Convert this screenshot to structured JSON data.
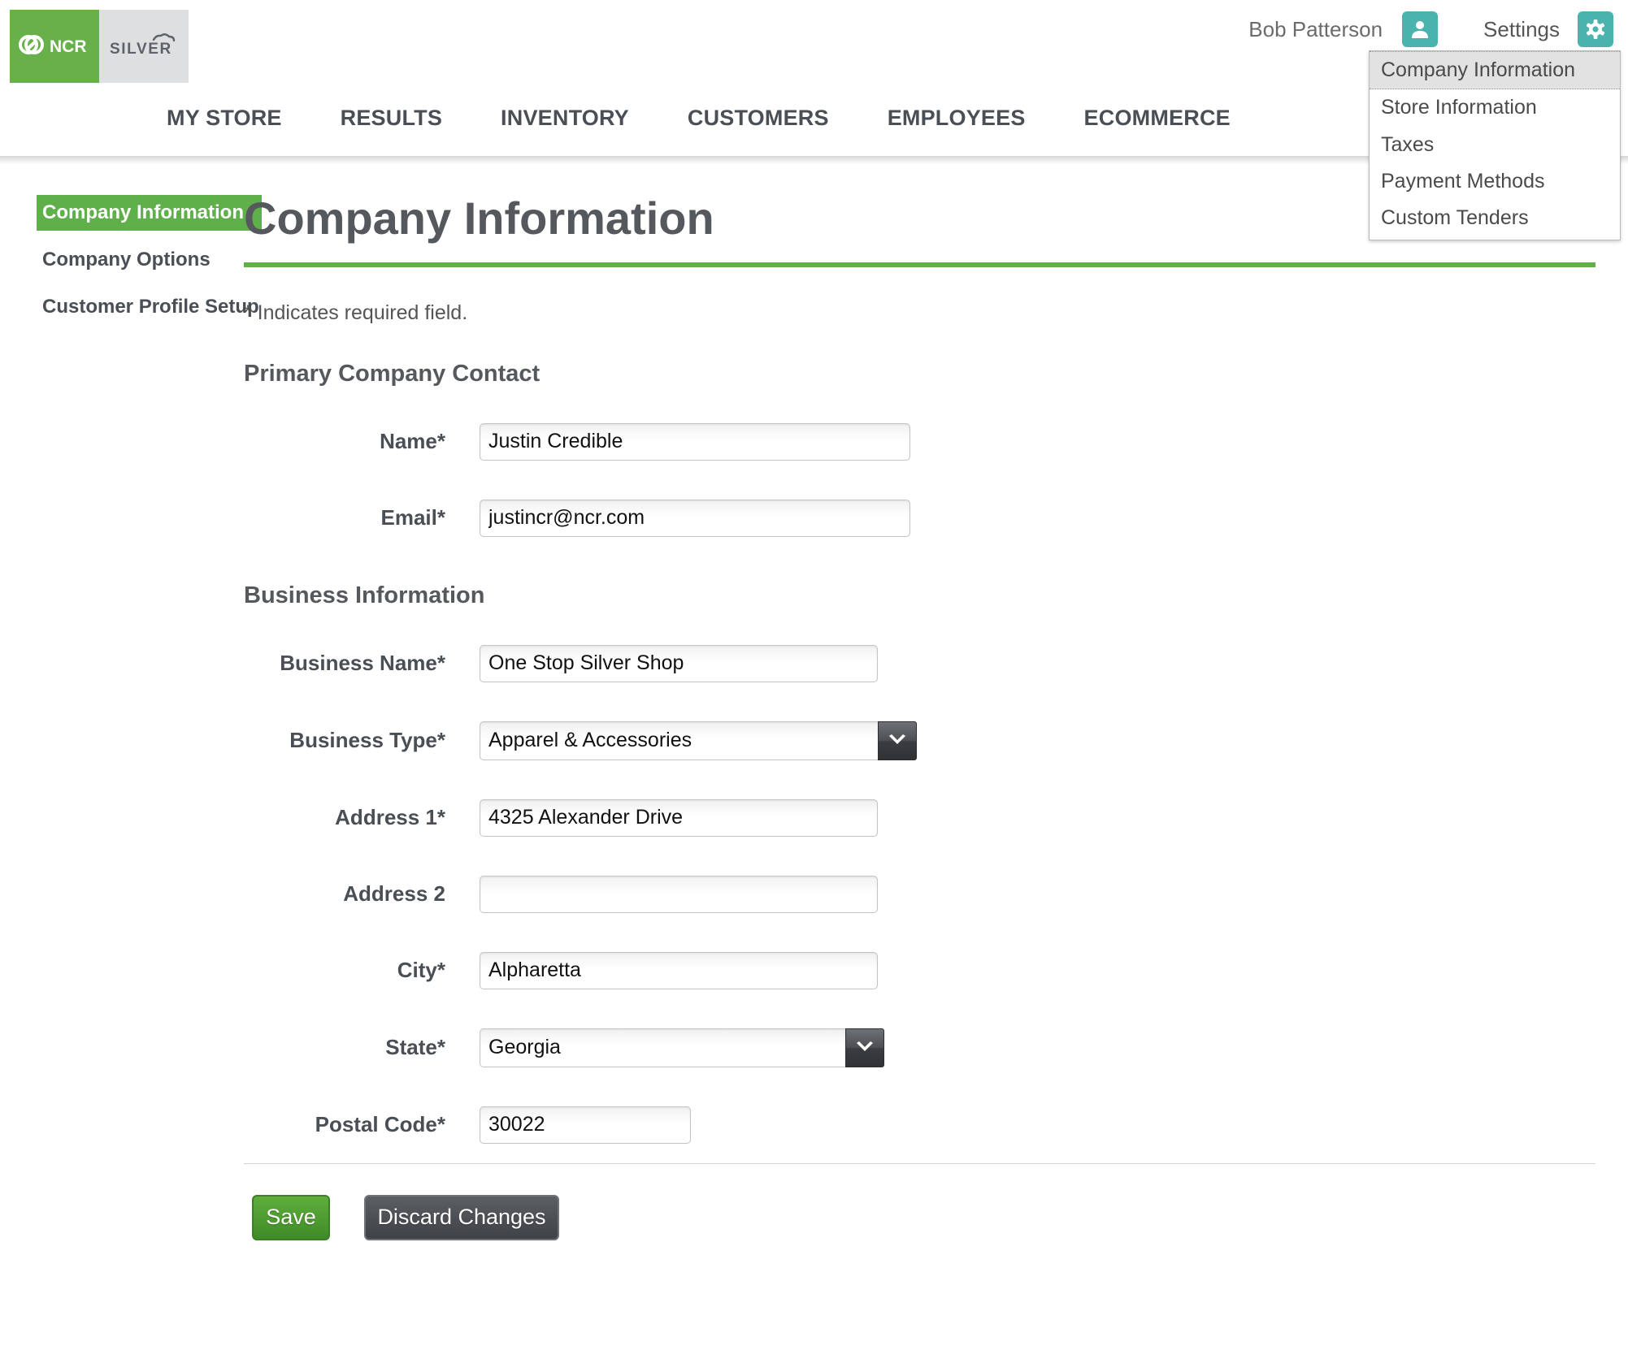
{
  "header": {
    "logo_primary": "NCR",
    "logo_secondary": "SILVER",
    "user_name": "Bob Patterson",
    "user_icon": "person-icon",
    "settings_label": "Settings",
    "settings_icon": "gear-icon",
    "accent_teal": "#4bb3ad",
    "accent_green": "#5fb04a"
  },
  "settings_menu": {
    "items": [
      {
        "label": "Company Information",
        "active": true
      },
      {
        "label": "Store Information",
        "active": false
      },
      {
        "label": "Taxes",
        "active": false
      },
      {
        "label": "Payment Methods",
        "active": false
      },
      {
        "label": "Custom Tenders",
        "active": false
      }
    ]
  },
  "main_nav": {
    "items": [
      {
        "label": "MY STORE"
      },
      {
        "label": "RESULTS"
      },
      {
        "label": "INVENTORY"
      },
      {
        "label": "CUSTOMERS"
      },
      {
        "label": "EMPLOYEES"
      },
      {
        "label": "ECOMMERCE"
      }
    ]
  },
  "sidebar": {
    "items": [
      {
        "label": "Company Information",
        "active": true
      },
      {
        "label": "Company Options",
        "active": false
      },
      {
        "label": "Customer Profile Setup",
        "active": false
      }
    ]
  },
  "main": {
    "title": "Company Information",
    "required_note": "* Indicates required field.",
    "sections": [
      {
        "title": "Primary Company Contact",
        "fields": [
          {
            "label": "Name*",
            "value": "Justin Credible",
            "type": "text",
            "placeholder": ""
          },
          {
            "label": "Email*",
            "value": "justincr@ncr.com",
            "type": "text",
            "placeholder": ""
          }
        ]
      },
      {
        "title": "Business Information",
        "fields": [
          {
            "label": "Business Name*",
            "value": "One Stop Silver Shop",
            "type": "text",
            "placeholder": ""
          },
          {
            "label": "Business Type*",
            "value": "Apparel & Accessories",
            "type": "select",
            "placeholder": ""
          },
          {
            "label": "Address 1*",
            "value": "4325 Alexander Drive",
            "type": "text",
            "placeholder": ""
          },
          {
            "label": "Address 2",
            "value": "",
            "type": "text",
            "placeholder": ""
          },
          {
            "label": "City*",
            "value": "Alpharetta",
            "type": "text",
            "placeholder": ""
          },
          {
            "label": "State*",
            "value": "Georgia",
            "type": "select",
            "placeholder": ""
          },
          {
            "label": "Postal Code*",
            "value": "30022",
            "type": "text",
            "placeholder": ""
          }
        ]
      }
    ]
  },
  "actions": {
    "save_label": "Save",
    "discard_label": "Discard Changes"
  }
}
